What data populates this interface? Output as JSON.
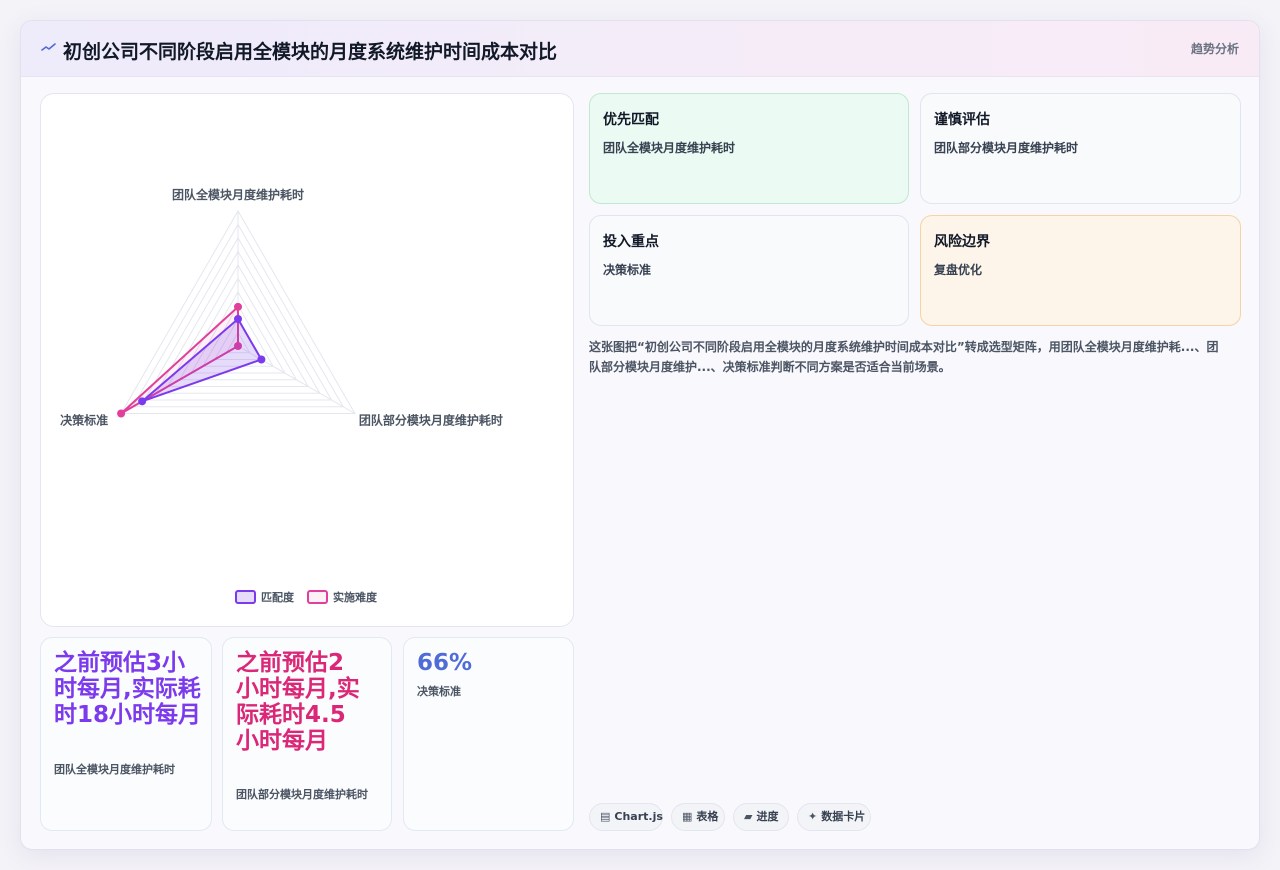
{
  "header": {
    "title": "初创公司不同阶段启用全模块的月度系统维护时间成本对比",
    "action_label": "趋势分析"
  },
  "cards": [
    {
      "title": "优先匹配",
      "subtitle": "团队全模块月度维护耗时"
    },
    {
      "title": "谨慎评估",
      "subtitle": "团队部分模块月度维护耗时"
    },
    {
      "title": "投入重点",
      "subtitle": "决策标准"
    },
    {
      "title": "风险边界",
      "subtitle": "复盘优化"
    }
  ],
  "description": "这张图把“初创公司不同阶段启用全模块的月度系统维护时间成本对比”转成选型矩阵，用团队全模块月度维护耗...、团队部分模块月度维护...、决策标准判断不同方案是否适合当前场景。",
  "stats": [
    {
      "value": "之前预估3小时每月,实际耗时18小时每月",
      "label": "团队全模块月度维护耗时",
      "color": "#7c3aed"
    },
    {
      "value": "之前预估2小时每月,实际耗时4.5小时每月",
      "label": "团队部分模块月度维护耗时",
      "color": "#db2777"
    },
    {
      "value": "66%",
      "label": "决策标准",
      "color": "#4f6bd8"
    }
  ],
  "chips": [
    {
      "icon": "▤",
      "label": "Chart.js"
    },
    {
      "icon": "▦",
      "label": "表格"
    },
    {
      "icon": "▰",
      "label": "进度"
    },
    {
      "icon": "✦",
      "label": "数据卡片"
    }
  ],
  "chart_data": {
    "type": "radar",
    "axes": [
      "团队全模块月度维护耗时",
      "团队部分模块月度维护耗时",
      "决策标准"
    ],
    "rmax": 100,
    "grid_levels": 10,
    "series": [
      {
        "name": "匹配度",
        "values": [
          20,
          20,
          82
        ],
        "color": "#7c3aed"
      },
      {
        "name": "实施难度",
        "values": [
          29,
          0,
          100
        ],
        "color": "#e0409a"
      }
    ],
    "legend_position": "bottom"
  }
}
